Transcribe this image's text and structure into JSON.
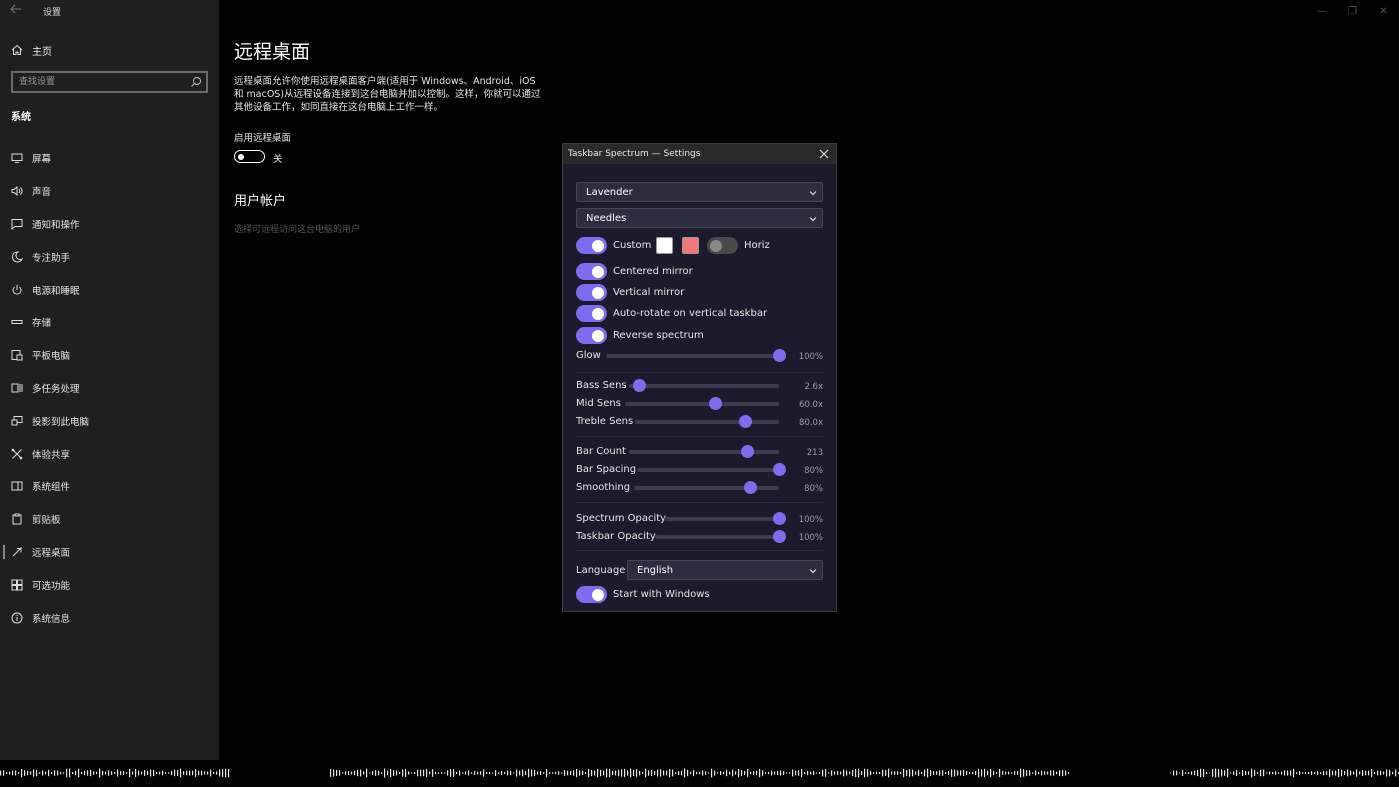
{
  "window": {
    "title": "设置",
    "controls": {
      "minimize": "—",
      "restore": "❐",
      "close": "✕"
    }
  },
  "sidebar": {
    "home_label": "主页",
    "search_placeholder": "查找设置",
    "section": "系统",
    "items": [
      {
        "label": "屏幕",
        "icon": "monitor-icon"
      },
      {
        "label": "声音",
        "icon": "speaker-icon"
      },
      {
        "label": "通知和操作",
        "icon": "notification-icon"
      },
      {
        "label": "专注助手",
        "icon": "moon-icon"
      },
      {
        "label": "电源和睡眠",
        "icon": "power-icon"
      },
      {
        "label": "存储",
        "icon": "storage-icon"
      },
      {
        "label": "平板电脑",
        "icon": "tablet-icon"
      },
      {
        "label": "多任务处理",
        "icon": "multitask-icon"
      },
      {
        "label": "投影到此电脑",
        "icon": "project-icon"
      },
      {
        "label": "体验共享",
        "icon": "share-icon"
      },
      {
        "label": "系统组件",
        "icon": "components-icon"
      },
      {
        "label": "剪贴板",
        "icon": "clipboard-icon"
      },
      {
        "label": "远程桌面",
        "icon": "remote-desktop-icon",
        "active": true
      },
      {
        "label": "可选功能",
        "icon": "optional-features-icon"
      },
      {
        "label": "系统信息",
        "icon": "info-icon"
      }
    ]
  },
  "main": {
    "title": "远程桌面",
    "description": "远程桌面允许你使用远程桌面客户端(适用于 Windows、Android、iOS 和 macOS)从远程设备连接到这台电脑并加以控制。这样，你就可以通过其他设备工作，如同直接在这台电脑上工作一样。",
    "toggle_label": "启用远程桌面",
    "toggle_state": "关",
    "users_title": "用户帐户",
    "users_desc": "选择可远程访问这台电脑的用户"
  },
  "dialog": {
    "title": "Taskbar Spectrum — Settings",
    "theme": "Lavender",
    "style": "Needles",
    "custom_label": "Custom",
    "horiz_label": "Horiz",
    "custom_colors": [
      "#ffffff",
      "#f07878"
    ],
    "toggles": {
      "centered_mirror": "Centered mirror",
      "vertical_mirror": "Vertical mirror",
      "auto_rotate": "Auto-rotate on vertical taskbar",
      "reverse": "Reverse spectrum",
      "start_windows": "Start with Windows"
    },
    "sliders": {
      "glow": {
        "label": "Glow",
        "value": "100%",
        "fraction": 1.0
      },
      "bass": {
        "label": "Bass Sens",
        "value": "2.6x",
        "fraction": 0.07
      },
      "mid": {
        "label": "Mid Sens",
        "value": "60.0x",
        "fraction": 0.59
      },
      "treble": {
        "label": "Treble Sens",
        "value": "80.0x",
        "fraction": 0.77
      },
      "bar_count": {
        "label": "Bar Count",
        "value": "213",
        "fraction": 0.79
      },
      "bar_spacing": {
        "label": "Bar Spacing",
        "value": "80%",
        "fraction": 1.0
      },
      "smoothing": {
        "label": "Smoothing",
        "value": "80%",
        "fraction": 0.8
      },
      "spectrum_opacity": {
        "label": "Spectrum Opacity",
        "value": "100%",
        "fraction": 1.0
      },
      "taskbar_opacity": {
        "label": "Taskbar Opacity",
        "value": "100%",
        "fraction": 1.0
      }
    },
    "language_label": "Language",
    "language": "English"
  },
  "colors": {
    "accent": "#7b6cf0",
    "sidebar_bg": "#1f1f1f",
    "dialog_bg": "#1c1b2c"
  }
}
